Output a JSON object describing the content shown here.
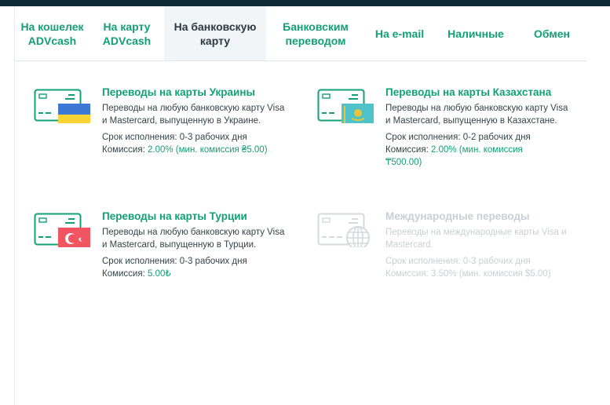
{
  "tabs": [
    {
      "line1": "На кошелек",
      "line2": "ADVcash",
      "active": false
    },
    {
      "line1": "На карту",
      "line2": "ADVcash",
      "active": false
    },
    {
      "line1": "На банковскую",
      "line2": "карту",
      "active": true
    },
    {
      "line1": "Банковским",
      "line2": "переводом",
      "active": false
    },
    {
      "line1": "На e-mail",
      "line2": "",
      "active": false
    },
    {
      "line1": "Наличные",
      "line2": "",
      "active": false
    },
    {
      "line1": "Обмен",
      "line2": "",
      "active": false
    }
  ],
  "cards": {
    "ukraine": {
      "title": "Переводы на карты Украины",
      "desc": "Переводы на любую банковскую карту Visa и Mastercard, выпущенную в Украине.",
      "term_label": "Срок исполнения:",
      "term_value": "0-3 рабочих дня",
      "fee_label": "Комиссия:",
      "fee_value": "2.00% (мин. комиссия ₴5.00)"
    },
    "kazakhstan": {
      "title": "Переводы на карты Казахстана",
      "desc": "Переводы на любую банковскую карту Visa и Mastercard, выпущенную в Казахстане.",
      "term_label": "Срок исполнения:",
      "term_value": "0-2 рабочих дня",
      "fee_label": "Комиссия:",
      "fee_value": "2.00% (мин. комиссия ₸500.00)"
    },
    "turkey": {
      "title": "Переводы на карты Турции",
      "desc": "Переводы на любую банковскую карту Visa и Mastercard, выпущенную в Турции.",
      "term_label": "Срок исполнения:",
      "term_value": "0-3 рабочих дня",
      "fee_label": "Комиссия:",
      "fee_value": "5.00₺"
    },
    "international": {
      "title": "Международные переводы",
      "desc": "Переводы на международные карты Visa и Mastercard.",
      "term_label": "Срок исполнения:",
      "term_value": "0-3 рабочих дня",
      "fee_label": "Комиссия:",
      "fee_value": "3.50% (мин. комиссия $5.00)"
    }
  },
  "colors": {
    "accent": "#12a075",
    "text": "#34434a",
    "disabled": "#c9cfd2",
    "topbar": "#0e2a36"
  }
}
